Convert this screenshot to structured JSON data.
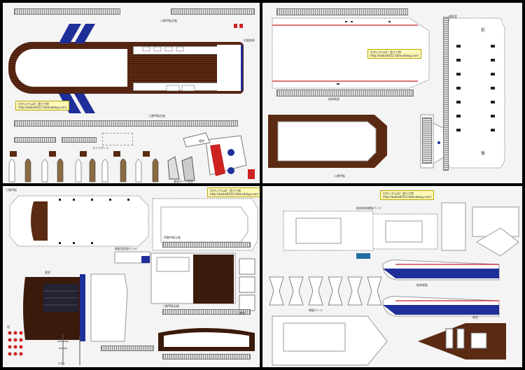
{
  "sheets": [
    {
      "url_line1": "わかいさんぼ！造り工房",
      "url_line2": "http://wakai0412.hatenablog.com/",
      "labels": {
        "top_deck": "二階甲板左舷",
        "side_right": "右舷船体",
        "hull_bottom": "三階甲板左舷",
        "deck3": "三階甲板左舷",
        "lifeboat": "ライフボート",
        "funnel": "煙突",
        "misc": "救命ボート用台"
      }
    },
    {
      "url_line1": "わかいさんぼ！造り工房",
      "url_line2": "http://wakai0412.hatenablog.com/",
      "labels": {
        "hull_side": "船体側面",
        "deck2": "二階甲板",
        "front": "前",
        "rear": "後",
        "bridge": "操舵室"
      }
    },
    {
      "url_line1": "わかいさんぼ！造り工房",
      "url_line2": "http://wakai0412.hatenablog.com/",
      "labels": {
        "deck_top": "三階甲板",
        "bridge_deck": "操舵室前部デッキ",
        "upper": "四階甲板左舷",
        "lower": "三階甲板右舷",
        "stairs": "階段",
        "mast": "マスト",
        "cabin": "客室",
        "window": "窓"
      }
    },
    {
      "url_line1": "わかいさんぼ！造り工房",
      "url_line2": "http://wakai0412.hatenablog.com/",
      "labels": {
        "deck_parts": "船体前部補強パーツ",
        "hull_side": "船体側面",
        "bow": "船首",
        "support": "補強パーツ"
      }
    }
  ],
  "colors": {
    "brown": "#5a2a12",
    "blue": "#1f2f9a",
    "red": "#cc2222",
    "sheet": "#f4f4f4"
  }
}
